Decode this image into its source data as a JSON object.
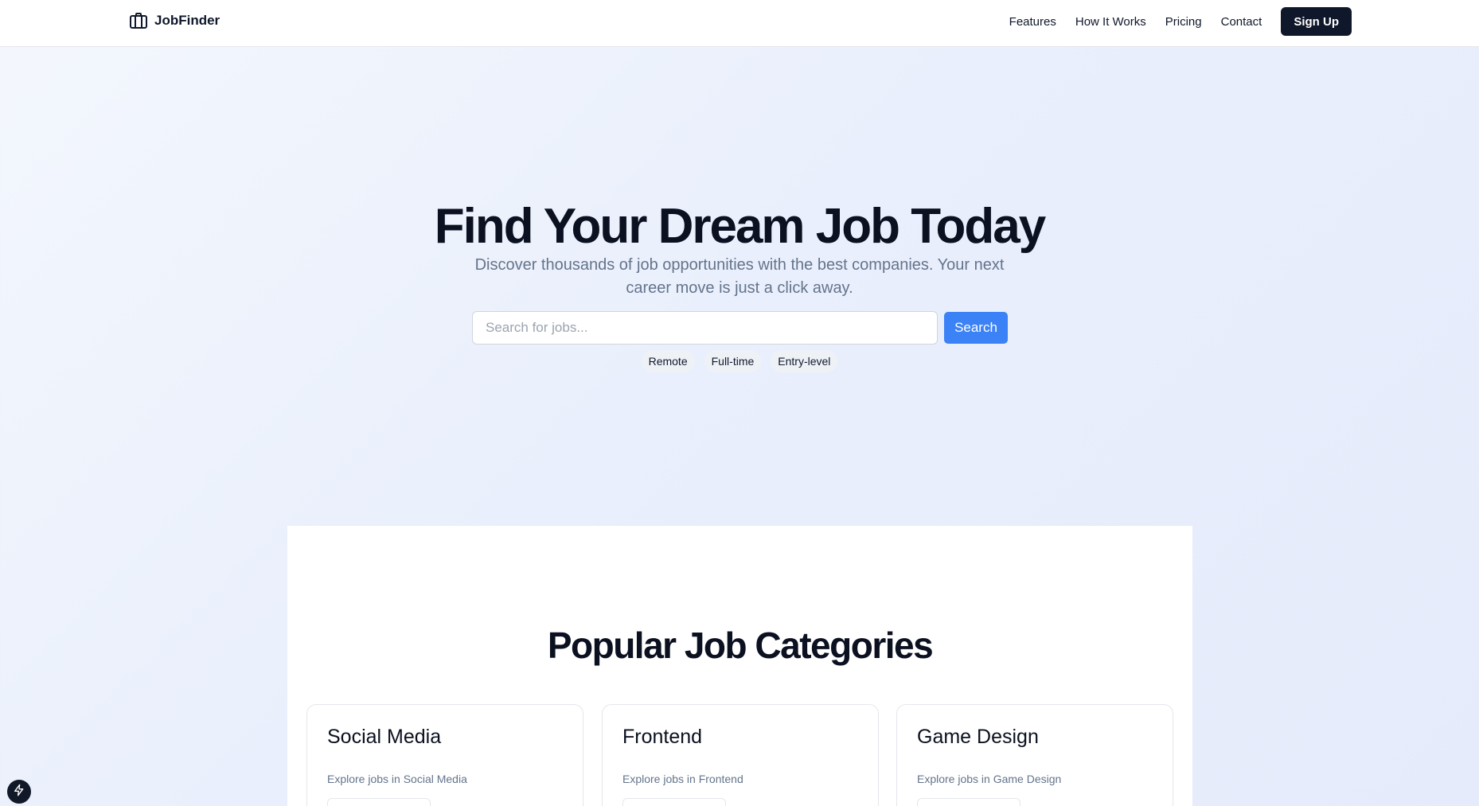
{
  "header": {
    "brand": "JobFinder",
    "brand_icon": "briefcase-icon",
    "nav": [
      {
        "label": "Features"
      },
      {
        "label": "How It Works"
      },
      {
        "label": "Pricing"
      },
      {
        "label": "Contact"
      }
    ],
    "signup_label": "Sign Up"
  },
  "hero": {
    "title": "Find Your Dream Job Today",
    "subtitle": "Discover thousands of job opportunities with the best companies. Your next career move is just a click away.",
    "search": {
      "placeholder": "Search for jobs...",
      "button_label": "Search"
    },
    "chips": [
      "Remote",
      "Full-time",
      "Entry-level"
    ]
  },
  "categories": {
    "title": "Popular Job Categories",
    "cards": [
      {
        "title": "Social Media",
        "description": "Explore jobs in Social Media"
      },
      {
        "title": "Frontend",
        "description": "Explore jobs in Frontend"
      },
      {
        "title": "Game Design",
        "description": "Explore jobs in Game Design"
      }
    ]
  },
  "colors": {
    "primary_dark": "#0f172a",
    "accent_blue": "#3b82f6",
    "muted_text": "#64748b"
  },
  "floating_badge_icon": "lightning-icon"
}
